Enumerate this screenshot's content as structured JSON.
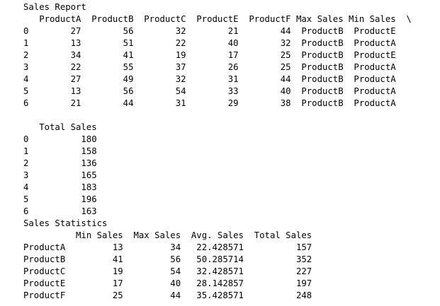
{
  "output": {
    "lines": [
      "Sales Report",
      "   ProductA  ProductB  ProductC  ProductE  ProductF Max Sales Min Sales  \\",
      "0        27        56        32        21        44  ProductB  ProductE",
      "1        13        51        22        40        32  ProductB  ProductA",
      "2        34        41        19        17        25  ProductB  ProductE",
      "3        22        55        37        26        25  ProductB  ProductA",
      "4        27        49        32        31        44  ProductB  ProductA",
      "5        13        56        54        33        40  ProductB  ProductA",
      "6        21        44        31        29        38  ProductB  ProductA",
      "",
      "   Total Sales",
      "0          180",
      "1          158",
      "2          136",
      "3          165",
      "4          183",
      "5          196",
      "6          163",
      "Sales Statistics",
      "          Min Sales  Max Sales  Avg. Sales  Total Sales",
      "ProductA         13         34   22.428571          157",
      "ProductB         41         56   50.285714          352",
      "ProductC         19         54   32.428571          227",
      "ProductE         17         40   28.142857          197",
      "ProductF         25         44   35.428571          248"
    ]
  }
}
